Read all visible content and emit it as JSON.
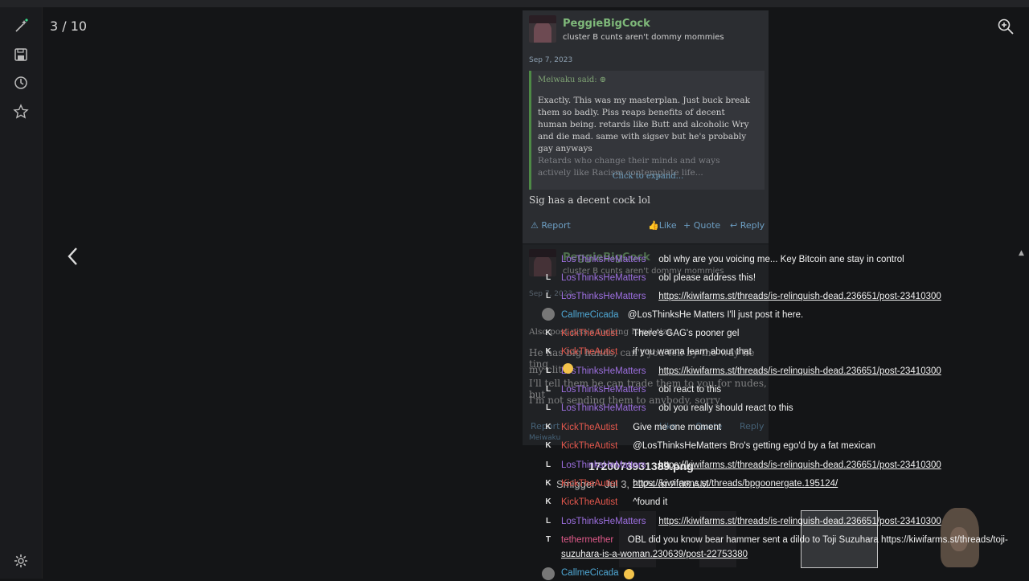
{
  "viewer": {
    "counter": "3 / 10",
    "icons": [
      "magic-icon",
      "save-icon",
      "history-icon",
      "star-icon",
      "settings-icon",
      "zoom-in-icon",
      "chevron-left-icon"
    ]
  },
  "post1": {
    "username": "PeggieBigCock",
    "user_title": "cluster B cunts aren't dommy mommies",
    "date": "Sep 7, 2023",
    "quote_author": "Meiwaku said: ⊕",
    "quote_text": "Exactly. This was my masterplan. Just buck break them so badly. Piss reaps benefits of decent human being. retards like Butt and alcoholic Wry and die mad. same with sigsev but he's probably gay anyways",
    "quote_faded": "Retards who change their minds and ways actively like Racism contemplate life...",
    "expand": "Click to expand...",
    "reply_text": "Sig has a decent cock lol",
    "report": "Report",
    "like": "Like",
    "quote": "+ Quote",
    "reply": "Reply"
  },
  "post2": {
    "username": "PeggieBigCock",
    "user_title": "cluster B cunts aren't dommy mommies",
    "date": "Sep 7, 2023",
    "line1": "Also post piss's fucking hand size",
    "line2": "He has big hands, can't you tell by the way he ting",
    "line3": "my clit",
    "line4": "I'll tell them he can trade them to you for nudes, but",
    "line5": "I'm not sending them to anybody, sorry",
    "report": "Report",
    "like": "Like",
    "quote": "Quote",
    "reply": "Reply",
    "reaction_user": "Meiwaku"
  },
  "chat": {
    "messages": [
      {
        "badge": "",
        "user": "LosThinksHeMatters",
        "text": "obl why are you voicing me... Key Bitcoin ane stay in control",
        "color": "#9d6fe0"
      },
      {
        "badge": "L",
        "user": "LosThinksHeMatters",
        "text": "obl please address this!",
        "color": "#9d6fe0"
      },
      {
        "badge": "L",
        "user": "LosThinksHeMatters",
        "text": "https://kiwifarms.st/threads/is-relinquish-dead.236651/post-23410300",
        "color": "#9d6fe0",
        "link": true
      },
      {
        "badge": "",
        "user": "CallmeCicada",
        "text": "@LosThinksHe Matters I'll just post it here.",
        "color": "#4fa9d6"
      },
      {
        "badge": "K",
        "user": "KickTheAutist",
        "text": "There's GAG's pooner gel",
        "color": "#e4584d"
      },
      {
        "badge": "K",
        "user": "KickTheAutist",
        "text": "if you wanna learn about that",
        "color": "#e4584d"
      },
      {
        "badge": "L",
        "user": "LosThinksHeMatters",
        "text": "https://kiwifarms.st/threads/is-relinquish-dead.236651/post-23410300",
        "color": "#9d6fe0",
        "link": true
      },
      {
        "badge": "L",
        "user": "LosThinksHeMatters",
        "text": "obl react to this",
        "color": "#9d6fe0"
      },
      {
        "badge": "L",
        "user": "LosThinksHeMatters",
        "text": "obl you really should react to this",
        "color": "#9d6fe0"
      },
      {
        "badge": "K",
        "user": "KickTheAutist",
        "text": "Give me one moment",
        "color": "#e4584d"
      },
      {
        "badge": "K",
        "user": "KickTheAutist",
        "text": "@LosThinksHeMatters Bro's getting ego'd by a fat mexican",
        "color": "#e4584d"
      },
      {
        "badge": "L",
        "user": "LosThinksHeMatters",
        "text": "https://kiwifarms.st/threads/is-relinquish-dead.236651/post-23410300",
        "color": "#9d6fe0",
        "link": true
      },
      {
        "badge": "K",
        "user": "KickTheAutist",
        "text": "https://kiwifarms.st/threads/bpgoonergate.195124/",
        "color": "#e4584d",
        "link": true
      },
      {
        "badge": "K",
        "user": "KickTheAutist",
        "text": "^found it",
        "color": "#e4584d"
      },
      {
        "badge": "L",
        "user": "LosThinksHeMatters",
        "text": "https://kiwifarms.st/threads/is-relinquish-dead.236651/post-23410300",
        "color": "#9d6fe0",
        "link": true
      },
      {
        "badge": "T",
        "user": "tethermether",
        "text": "OBL did you know bear hammer sent a dildo to Toji Suzuhara https://kiwifarms.st/threads/toji-",
        "color": "#e05a8a"
      },
      {
        "badge": "",
        "user": "",
        "text": "suzuhara-is-a-woman.230639/post-22753380",
        "color": "#e05a8a",
        "link": true
      },
      {
        "badge": "",
        "user": "CallmeCicada",
        "text": "",
        "color": "#4fa9d6"
      }
    ]
  },
  "overlay": {
    "file_name": "1720073931389.png",
    "file_sub": "Smigger - Jul 3, 2024 at 2:08 AM"
  }
}
